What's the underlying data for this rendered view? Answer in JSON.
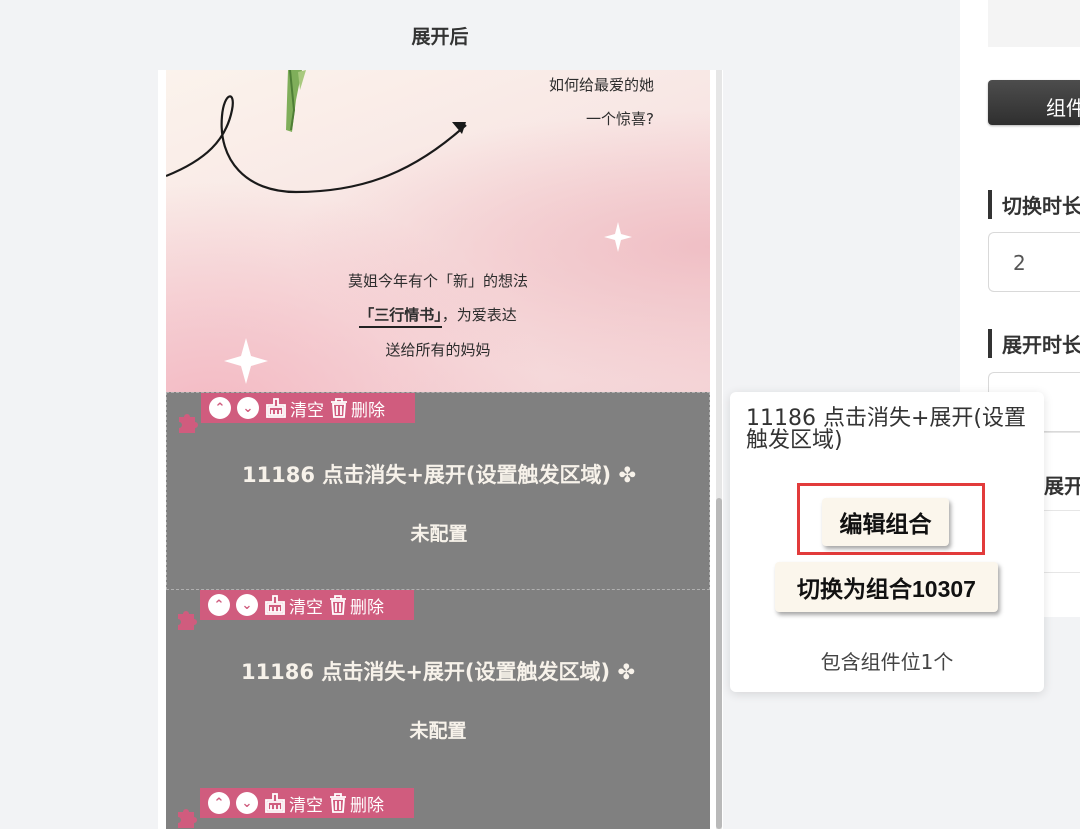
{
  "section_title": "展开后",
  "banner": {
    "line1": "如何给最爱的她",
    "line2": "一个惊喜?",
    "para1": "莫姐今年有个「新」的想法",
    "para2_bold": "「三行情书」",
    "para2_rest": "，为爱表达",
    "para3": "送给所有的妈妈"
  },
  "toolbar": {
    "clear_label": "清空",
    "delete_label": "删除"
  },
  "blocks": [
    {
      "title": "11186 点击消失+展开(设置触发区域)",
      "status": "未配置"
    },
    {
      "title": "11186 点击消失+展开(设置触发区域)",
      "status": "未配置"
    },
    {
      "title": "",
      "status": ""
    }
  ],
  "popup": {
    "title": "11186 点击消失+展开(设置触发区域)",
    "edit_button": "编辑组合",
    "switch_button": "切换为组合10307",
    "footer": "包含组件位1个"
  },
  "right_panel": {
    "tab_label": "组件",
    "switch_duration_label": "切换时长",
    "switch_duration_value": "2",
    "expand_duration_label": "展开时长",
    "expand_label_partial": "展开"
  },
  "colors": {
    "toolbar_pink": "#d05c7e",
    "block_gray": "#808080",
    "highlight_red": "#e23b3b"
  }
}
